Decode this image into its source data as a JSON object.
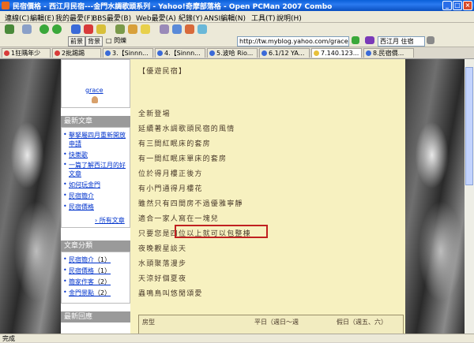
{
  "window": {
    "title": "民宿價格 - 西江月民宿---金門水調歌頭系列 - Yahoo!奇摩部落格 - Open PCMan 2007 Combo",
    "buttons": [
      "_",
      "□",
      "×"
    ]
  },
  "menu": [
    "連線(C)",
    "編輯(E)",
    "我的最愛(F)",
    "BBS最愛(B)",
    "Web最愛(A)",
    "紀錄(Y)",
    "ANSI編輯(N)",
    "工具(T)",
    "說明(H)"
  ],
  "toolbar2": {
    "front": "前景",
    "back": "背景",
    "blink": "閃爍",
    "address": "http://tw.myblog.yahoo.com/gracehox",
    "search": "西江月 住宿"
  },
  "tabs": [
    {
      "label": "1狂隅年少",
      "active": false
    },
    {
      "label": "2批踢踢",
      "active": false
    },
    {
      "label": "3.【Sinnn...",
      "active": false
    },
    {
      "label": "4.【Sinnn...",
      "active": false
    },
    {
      "label": "5.波哈 Rio...",
      "active": false
    },
    {
      "label": "6.1/12 YA...",
      "active": false
    },
    {
      "label": "7.140.123...",
      "active": true
    },
    {
      "label": "8.民宿價...",
      "active": false
    }
  ],
  "sidebar": {
    "profile_name": "grace",
    "recent_title": "最新文章",
    "recent": [
      "擊拏屬四月重新開放申請",
      "快樂歌",
      "一篇了解西江月的好文章",
      "如何玩金門",
      "民宿簡介",
      "民宿價格"
    ],
    "all_posts": "所有文章",
    "categories_title": "文章分類",
    "categories": [
      {
        "name": "民宿簡介",
        "count": "（1）"
      },
      {
        "name": "民宿價格",
        "count": "（1）"
      },
      {
        "name": "簡家作客",
        "count": "（2）"
      },
      {
        "name": "金門景點",
        "count": "（2）"
      }
    ],
    "replies_title": "最新回應"
  },
  "article": {
    "heading": "【優遊民宿】",
    "lines": [
      "全新登場",
      "延續著水調歌頭民宿的風情",
      "有三間紅眠床的套房",
      "有一間紅眠床單床的套房",
      "位於得月樓正後方",
      "有小門通得月樓花",
      "雖然只有四間房不過優雅寧靜",
      "適合一家人窩在一塊兒",
      "只要您是四位以上就可以包整棟",
      "夜晚觀星談天",
      "水頭聚落漫步",
      "天涼好個夏夜",
      "蟲鳴鳥叫悠閒頌愛"
    ],
    "table_headers": [
      "房型",
      "平日（週日～週",
      "假日（週五、六）"
    ]
  },
  "status": "完成"
}
